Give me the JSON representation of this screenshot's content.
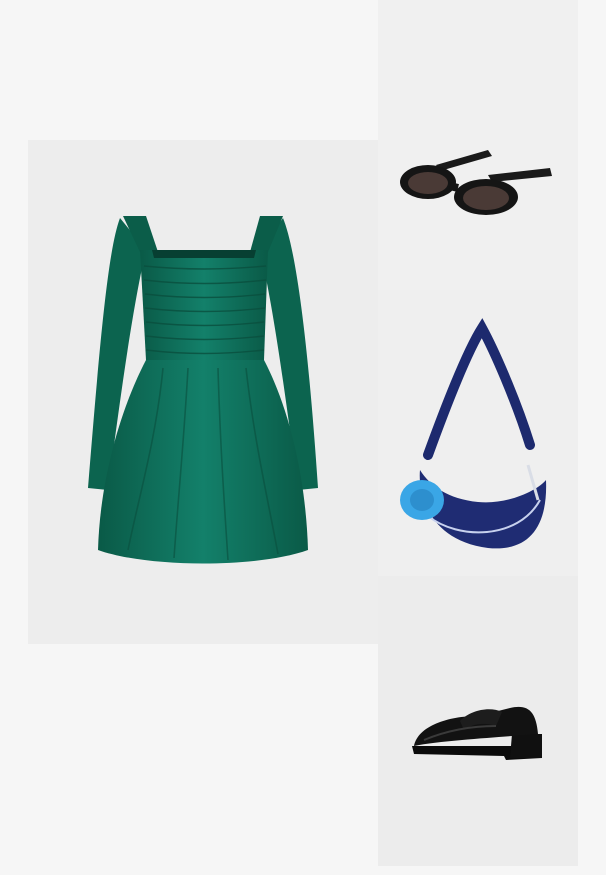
{
  "outfit": {
    "items": [
      {
        "icon": "dress-icon",
        "color": "#0e6b55"
      },
      {
        "icon": "sunglasses-icon",
        "color": "#1a1a1a"
      },
      {
        "icon": "shoulder-bag-icon",
        "color": "#1d2a6e",
        "accent": "#3aa6e6"
      },
      {
        "icon": "loafer-icon",
        "color": "#121212"
      }
    ]
  }
}
